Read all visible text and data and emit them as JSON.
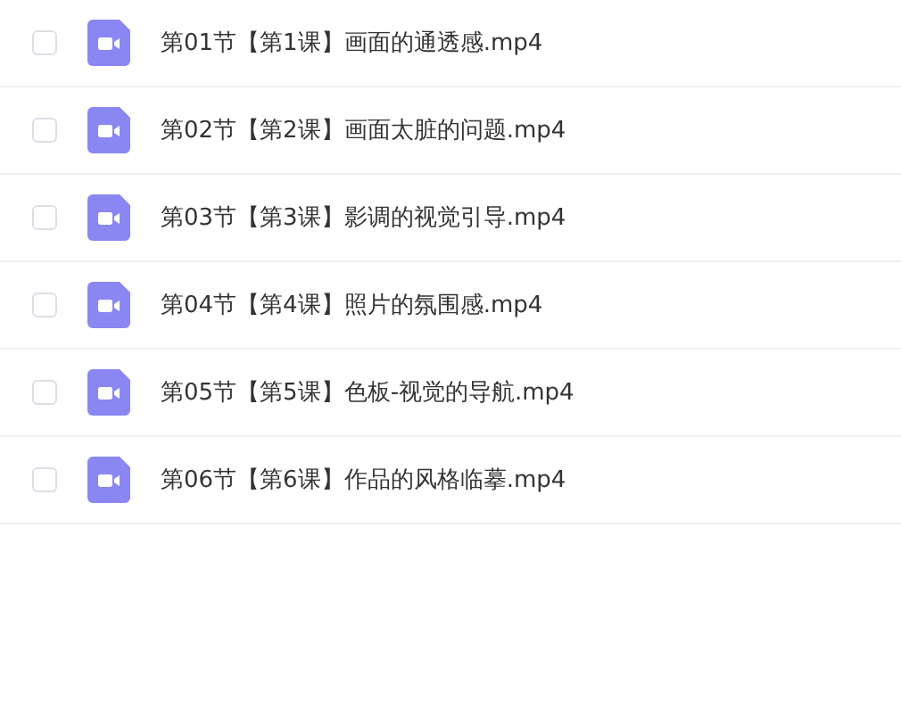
{
  "files": [
    {
      "name": "第01节【第1课】画面的通透感.mp4",
      "checked": false
    },
    {
      "name": "第02节【第2课】画面太脏的问题.mp4",
      "checked": false
    },
    {
      "name": "第03节【第3课】影调的视觉引导.mp4",
      "checked": false
    },
    {
      "name": "第04节【第4课】照片的氛围感.mp4",
      "checked": false
    },
    {
      "name": "第05节【第5课】色板-视觉的导航.mp4",
      "checked": false
    },
    {
      "name": "第06节【第6课】作品的风格临摹.mp4",
      "checked": false
    }
  ]
}
